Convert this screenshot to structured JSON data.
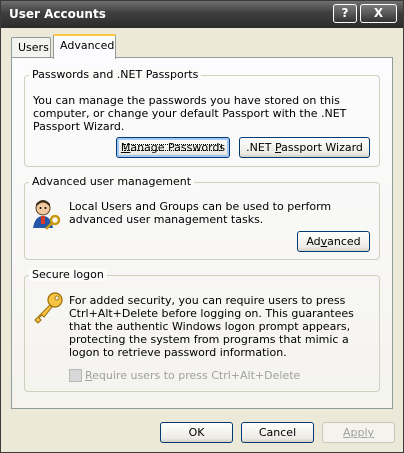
{
  "window": {
    "title": "User Accounts",
    "help_glyph": "?",
    "close_glyph": "X"
  },
  "tabs": [
    {
      "label": "Users",
      "selected": false
    },
    {
      "label": "Advanced",
      "selected": true
    }
  ],
  "passwords_group": {
    "title": "Passwords and .NET Passports",
    "description": "You can manage the passwords you have stored on this computer, or change your default Passport with the .NET Passport Wizard.",
    "manage_button": {
      "label": "Manage Passwords",
      "mnemonic": "M",
      "rest": "anage Passwords"
    },
    "wizard_button": {
      "label": ".NET Passport Wizard",
      "pre": ".NET ",
      "mnemonic": "P",
      "rest": "assport Wizard"
    }
  },
  "advanced_group": {
    "title": "Advanced user management",
    "description": "Local Users and Groups can be used to perform advanced user management tasks.",
    "advanced_button": {
      "label": "Advanced",
      "pre": "Ad",
      "mnemonic": "v",
      "rest": "anced"
    }
  },
  "secure_group": {
    "title": "Secure logon",
    "description": "For added security, you can require users to press Ctrl+Alt+Delete before logging on. This guarantees that the authentic Windows logon prompt appears, protecting the system from programs that mimic a logon to retrieve password information.",
    "checkbox": {
      "label": "Require users to press Ctrl+Alt+Delete",
      "mnemonic": "R",
      "rest": "equire users to press Ctrl+Alt+Delete",
      "checked": false,
      "enabled": false
    }
  },
  "footer": {
    "ok_label": "OK",
    "cancel_label": "Cancel",
    "apply_label": "Apply",
    "apply_enabled": false
  },
  "colors": {
    "window_bg": "#ece9d8",
    "titlebar": "#3e3e3e",
    "tab_highlight": "#ffc83c",
    "button_border": "#003c74"
  }
}
